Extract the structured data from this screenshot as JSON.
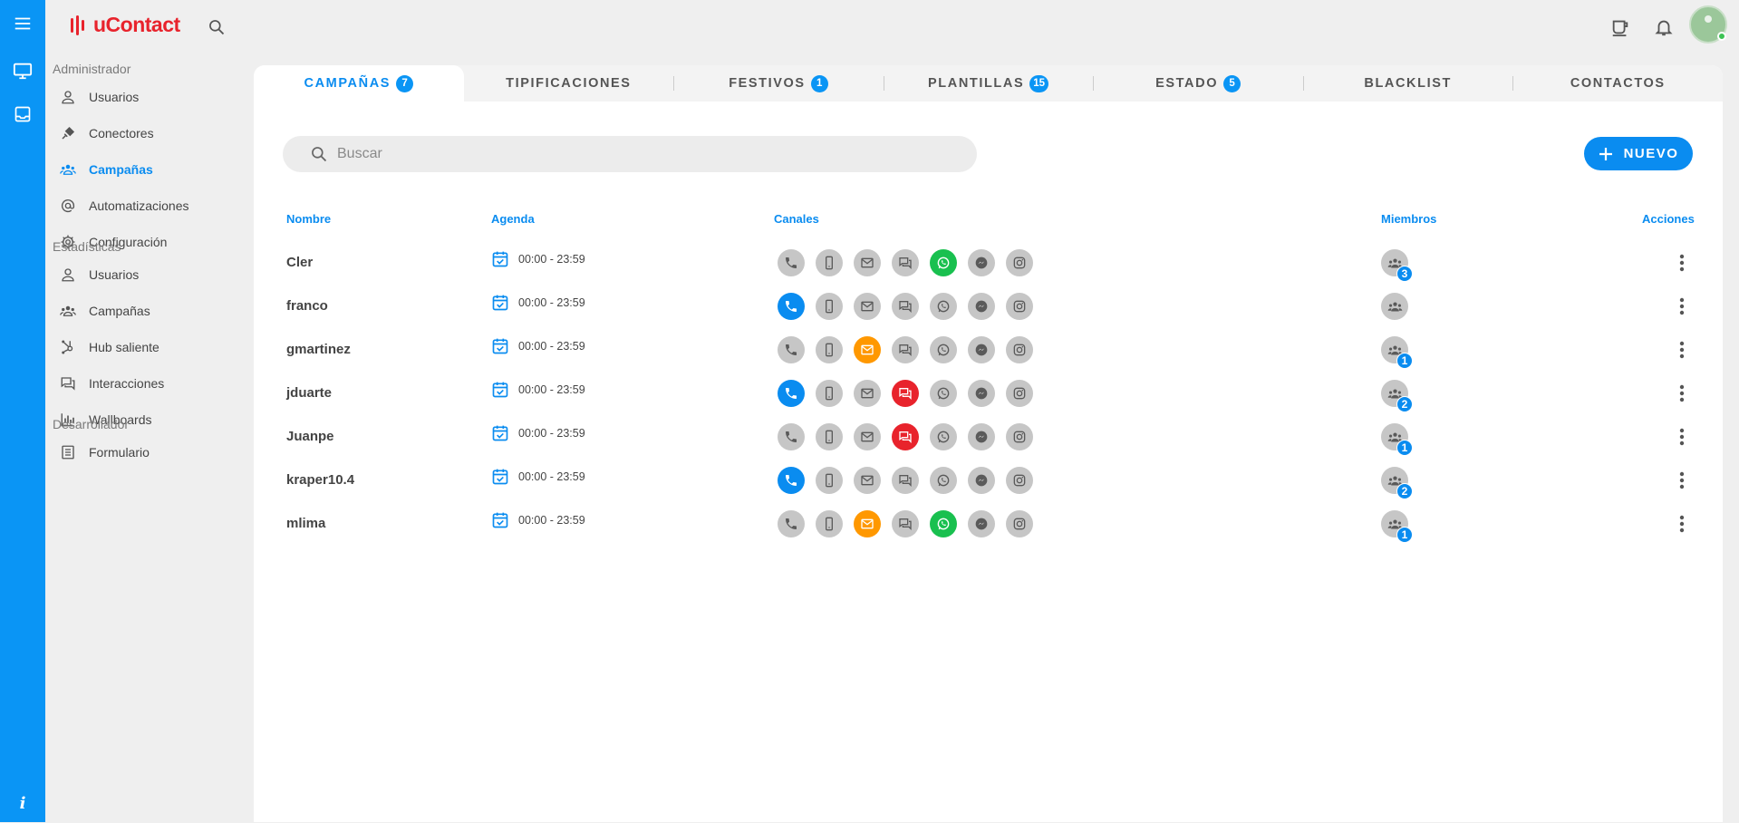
{
  "app": {
    "name": "uContact"
  },
  "colors": {
    "accent": "#0a8cf0",
    "phone": "#0a8cf0",
    "email": "#ff9800",
    "chat": "#e8232c",
    "whatsapp": "#19c04f",
    "inactive": "#c6c6c6"
  },
  "sidebar": {
    "sections": [
      {
        "title": "Administrador",
        "items": [
          {
            "label": "Usuarios",
            "icon": "user-icon"
          },
          {
            "label": "Conectores",
            "icon": "plug-icon"
          },
          {
            "label": "Campañas",
            "icon": "group-icon",
            "active": true
          },
          {
            "label": "Automatizaciones",
            "icon": "at-icon"
          },
          {
            "label": "Configuración",
            "icon": "gear-icon"
          }
        ]
      },
      {
        "title": "Estadísticas",
        "items": [
          {
            "label": "Usuarios",
            "icon": "user-icon"
          },
          {
            "label": "Campañas",
            "icon": "group-icon"
          },
          {
            "label": "Hub saliente",
            "icon": "hub-icon"
          },
          {
            "label": "Interacciones",
            "icon": "chat-icon"
          },
          {
            "label": "Wallboards",
            "icon": "bar-chart-icon"
          }
        ]
      },
      {
        "title": "Desarrollador",
        "items": [
          {
            "label": "Formulario",
            "icon": "form-icon"
          }
        ]
      }
    ]
  },
  "tabs": [
    {
      "label": "CAMPAÑAS",
      "badge": "7",
      "active": true
    },
    {
      "label": "TIPIFICACIONES",
      "badge": ""
    },
    {
      "label": "FESTIVOS",
      "badge": "1"
    },
    {
      "label": "PLANTILLAS",
      "badge": "15"
    },
    {
      "label": "ESTADO",
      "badge": "5"
    },
    {
      "label": "BLACKLIST",
      "badge": ""
    },
    {
      "label": "CONTACTOS",
      "badge": ""
    }
  ],
  "search": {
    "placeholder": "Buscar"
  },
  "toolbar": {
    "new_label": "NUEVO"
  },
  "table": {
    "headers": {
      "name": "Nombre",
      "agenda": "Agenda",
      "channels": "Canales",
      "members": "Miembros",
      "actions": "Acciones"
    },
    "channel_types": [
      "phone",
      "mobile",
      "email",
      "chat",
      "whatsapp",
      "messenger",
      "instagram"
    ],
    "rows": [
      {
        "name": "Cler",
        "agenda": "00:00 - 23:59",
        "active_channels": [
          "whatsapp"
        ],
        "members": "3"
      },
      {
        "name": "franco",
        "agenda": "00:00 - 23:59",
        "active_channels": [
          "phone"
        ],
        "members": ""
      },
      {
        "name": "gmartinez",
        "agenda": "00:00 - 23:59",
        "active_channels": [
          "email"
        ],
        "members": "1"
      },
      {
        "name": "jduarte",
        "agenda": "00:00 - 23:59",
        "active_channels": [
          "phone",
          "chat"
        ],
        "members": "2"
      },
      {
        "name": "Juanpe",
        "agenda": "00:00 - 23:59",
        "active_channels": [
          "chat"
        ],
        "members": "1"
      },
      {
        "name": "kraper10.4",
        "agenda": "00:00 - 23:59",
        "active_channels": [
          "phone"
        ],
        "members": "2"
      },
      {
        "name": "mlima",
        "agenda": "00:00 - 23:59",
        "active_channels": [
          "email",
          "whatsapp"
        ],
        "members": "1"
      }
    ]
  }
}
